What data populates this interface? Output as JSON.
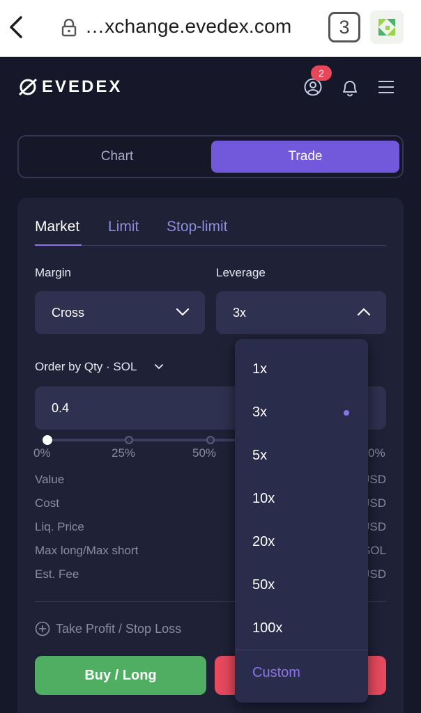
{
  "browser": {
    "url": "…xchange.evedex.com",
    "tab_count": "3"
  },
  "header": {
    "logo_text": "EVEDEX",
    "notification_badge": "2"
  },
  "segmented": {
    "chart_label": "Chart",
    "trade_label": "Trade"
  },
  "order_tabs": {
    "market": "Market",
    "limit": "Limit",
    "stop_limit": "Stop-limit"
  },
  "margin": {
    "label": "Margin",
    "value": "Cross"
  },
  "leverage": {
    "label": "Leverage",
    "value": "3x"
  },
  "order_by": {
    "label": "Order by Qty · SOL",
    "quantity": "0.4"
  },
  "slider": {
    "ticks": [
      "0%",
      "25%",
      "50%",
      "0%"
    ],
    "position": 0
  },
  "info": {
    "value_label": "Value",
    "value_unit": "USD",
    "cost_label": "Cost",
    "cost_unit": "USD",
    "liq_label": "Liq. Price",
    "liq_unit": "USD",
    "max_label": "Max long/Max short",
    "max_unit": "SOL",
    "fee_label": "Est. Fee",
    "fee_unit": "USD"
  },
  "tpsl_label": "Take Profit / Stop Loss",
  "buy_label": "Buy / Long",
  "leverage_options": [
    "1x",
    "3x",
    "5x",
    "10x",
    "20x",
    "50x",
    "100x"
  ],
  "leverage_selected": "3x",
  "custom_label": "Custom",
  "colors": {
    "accent": "#7258db",
    "buy": "#4fae62",
    "sell": "#e84a5f",
    "badge": "#e8475a"
  }
}
